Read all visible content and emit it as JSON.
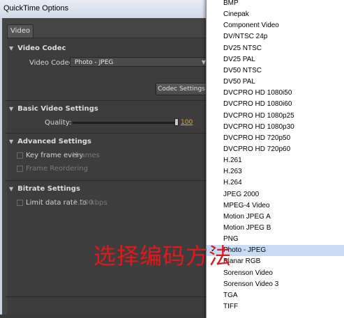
{
  "window": {
    "title": "QuickTime Options"
  },
  "tabs": [
    {
      "label": "Video"
    }
  ],
  "video_codec": {
    "heading": "Video Codec",
    "codec_label": "Video Codec:",
    "codec_value": "Photo - JPEG",
    "settings_button": "Codec Settings"
  },
  "basic_video": {
    "heading": "Basic Video Settings",
    "quality_label": "Quality:",
    "quality_value": "100",
    "quality_fraction": 1.0
  },
  "advanced": {
    "heading": "Advanced Settings",
    "keyframe_label": "Key frame every",
    "keyframe_value": "1",
    "keyframe_unit": "frames",
    "frame_reordering_label": "Frame Reordering"
  },
  "bitrate": {
    "heading": "Bitrate Settings",
    "limit_label": "Limit data rate to",
    "limit_value": "1,000",
    "limit_unit": "kbps"
  },
  "codec_list": {
    "items": [
      "BMP",
      "Cinepak",
      "Component Video",
      "DV/NTSC 24p",
      "DV25 NTSC",
      "DV25 PAL",
      "DV50 NTSC",
      "DV50 PAL",
      "DVCPRO HD 1080i50",
      "DVCPRO HD 1080i60",
      "DVCPRO HD 1080p25",
      "DVCPRO HD 1080p30",
      "DVCPRO HD 720p50",
      "DVCPRO HD 720p60",
      "H.261",
      "H.263",
      "H.264",
      "JPEG 2000",
      "MPEG-4 Video",
      "Motion JPEG A",
      "Motion JPEG B",
      "PNG",
      "Photo - JPEG",
      "Planar RGB",
      "Sorenson Video",
      "Sorenson Video 3",
      "TGA",
      "TIFF"
    ],
    "selected_index": 22
  },
  "annotation": {
    "text": "选择编码方法"
  },
  "colors": {
    "accent": "#e7a52b",
    "annotation": "#e0191b",
    "selection": "#c9dbf4"
  }
}
